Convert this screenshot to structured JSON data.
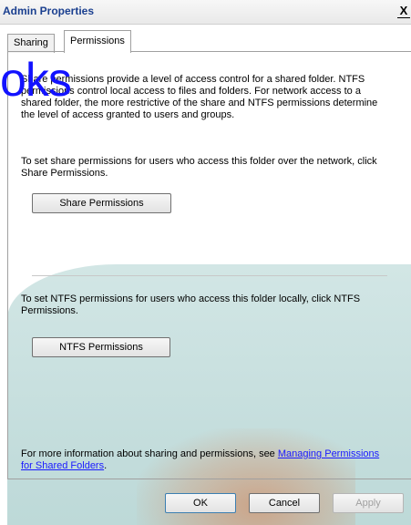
{
  "window": {
    "title": "Admin Properties",
    "close_glyph": "X"
  },
  "tabs": [
    {
      "label": "Sharing",
      "active": false
    },
    {
      "label": "Permissions",
      "active": true
    }
  ],
  "watermark": {
    "text": "oks",
    "color": "#1212ff"
  },
  "panel": {
    "intro_text": "Share permissions provide a level of access control for a shared folder. NTFS permissions control local access to files and folders. For network access to a shared folder, the more restrictive of the share and NTFS permissions determine the level of access granted to users and groups.",
    "share_text": "To set share permissions for users who access this folder over the network, click Share Permissions.",
    "share_button": "Share Permissions",
    "ntfs_text": "To set NTFS permissions for users who access this folder locally, click NTFS Permissions.",
    "ntfs_button": "NTFS Permissions",
    "info_prefix": "For more information about sharing and permissions, see ",
    "info_link": "Managing Permissions for Shared Folders",
    "info_suffix": "."
  },
  "buttons": {
    "ok": "OK",
    "cancel": "Cancel",
    "apply": "Apply"
  },
  "colors": {
    "title": "#1a3f8f",
    "link": "#1a1aff",
    "background_teal": "#c4dedd",
    "background_orange": "#d67846"
  }
}
